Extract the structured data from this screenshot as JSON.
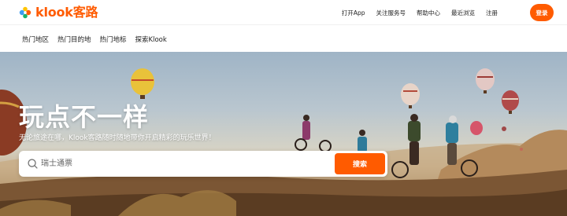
{
  "brand": {
    "name": "klook客路",
    "accent": "#ff5b00"
  },
  "topnav": {
    "items": [
      "打开App",
      "关注服务号",
      "帮助中心",
      "最近浏览",
      "注册"
    ],
    "login_label": "登录"
  },
  "subnav": {
    "items": [
      "热门地区",
      "热门目的地",
      "热门地标",
      "探索Klook"
    ]
  },
  "hero": {
    "title": "玩点不一样",
    "subtitle": "无论旅途在哪，Klook客路随时随地带你开启精彩的玩乐世界！"
  },
  "search": {
    "placeholder": "瑞士通票",
    "button_label": "搜索"
  }
}
